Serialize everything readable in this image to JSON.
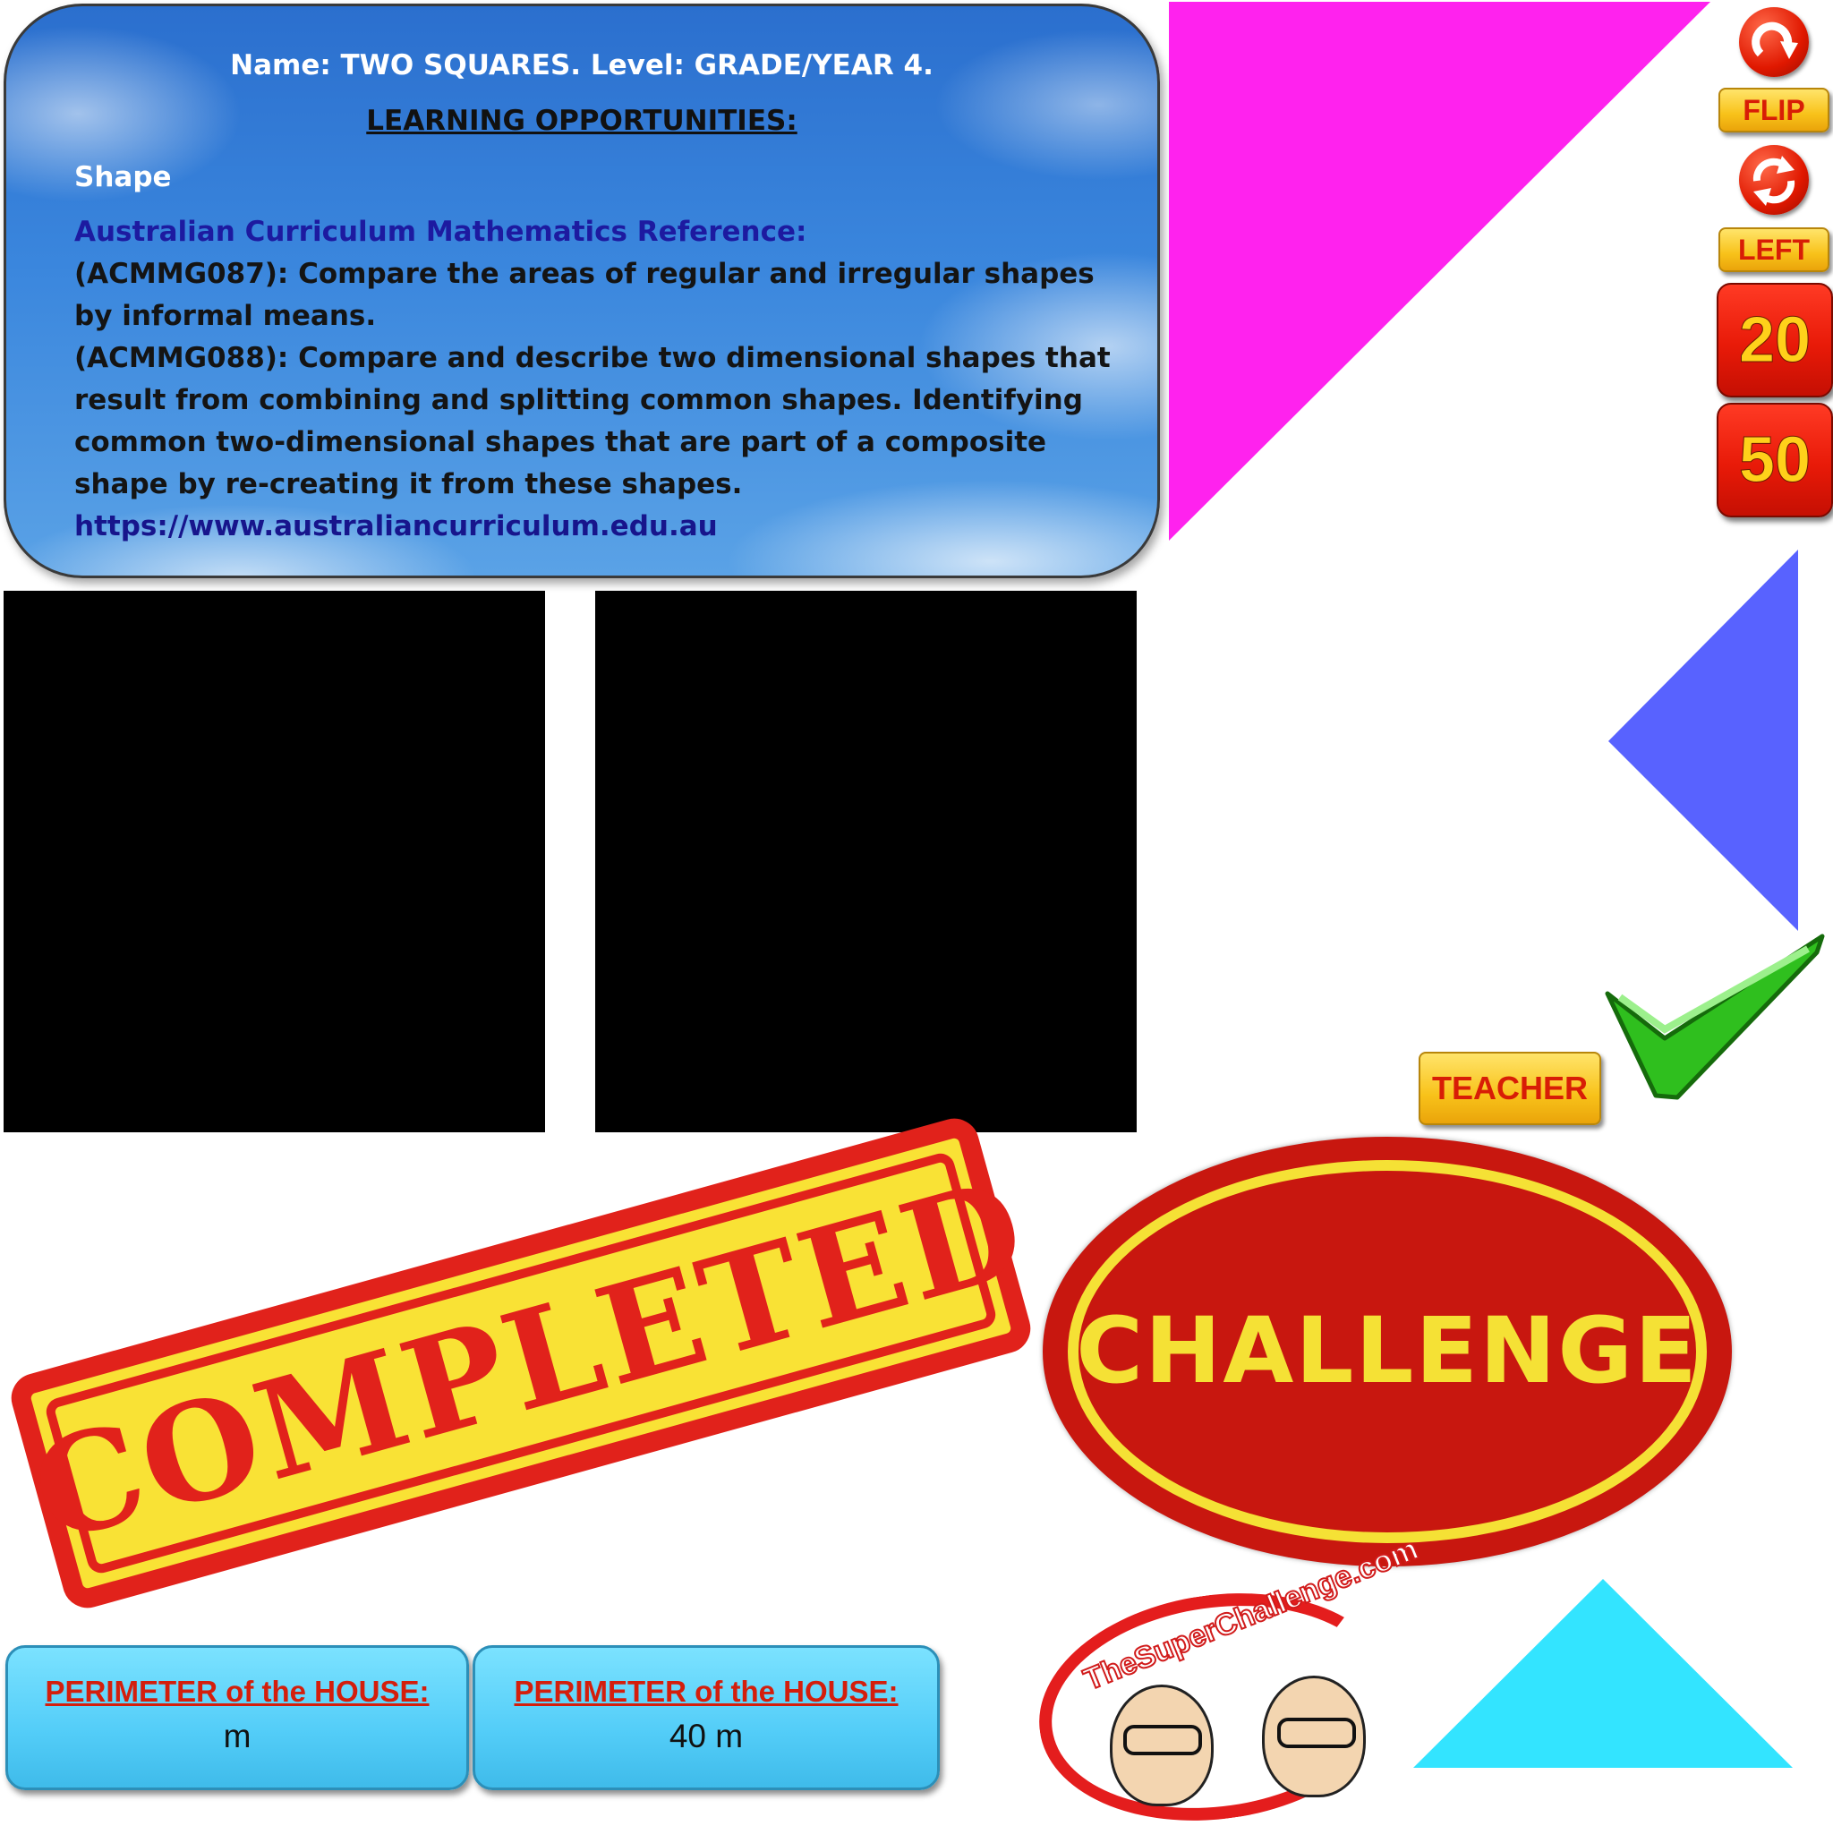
{
  "info": {
    "title": "Name: TWO SQUARES. Level: GRADE/YEAR 4.",
    "subtitle": "LEARNING OPPORTUNITIES:",
    "topic": "Shape",
    "reference_heading": "Australian Curriculum Mathematics Reference:",
    "paragraph1": "(ACMMG087): Compare the areas of regular and irregular shapes by informal means.",
    "paragraph2": "(ACMMG088): Compare and describe two dimensional shapes that result from combining and splitting common shapes. Identifying common two-dimensional shapes that are part of a composite shape by re-creating it from these shapes.",
    "url": "https://www.australiancurriculum.edu.au"
  },
  "controls": {
    "flip_label": "FLIP",
    "left_label": "LEFT",
    "count_20": "20",
    "count_50": "50",
    "teacher_label": "TEACHER"
  },
  "stamps": {
    "completed": "COMPLETED",
    "challenge": "CHALLENGE"
  },
  "logo": {
    "text": "TheSuperChallenge.com"
  },
  "perimeter": {
    "left_label": "PERIMETER of the HOUSE:",
    "left_value": "m",
    "right_label": "PERIMETER of the HOUSE:",
    "right_value": "40 m"
  },
  "colors": {
    "magenta_piece": "#ff22ee",
    "blue_piece": "#5862ff",
    "cyan_piece": "#33e4ff",
    "check": "#2fbf1e"
  },
  "icons": {
    "flip": "rotate-arrow-icon",
    "rotate_left": "refresh-arrows-icon",
    "submit": "green-checkmark-icon"
  }
}
